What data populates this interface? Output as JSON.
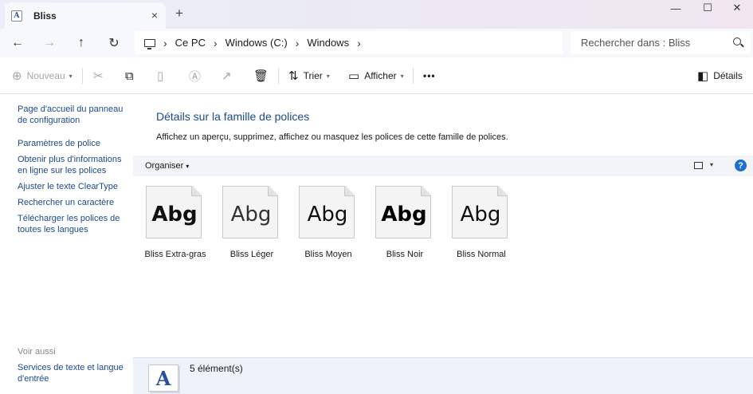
{
  "window": {
    "tab_title": "Bliss",
    "tab_icon_letter": "A",
    "tab_close_icon": "×",
    "new_tab_icon": "+",
    "minimize_icon": "—",
    "maximize_icon": "☐",
    "close_icon": "✕"
  },
  "nav": {
    "back_icon": "←",
    "forward_icon": "→",
    "up_icon": "↑",
    "refresh_icon": "↻",
    "breadcrumb": [
      "Ce PC",
      "Windows (C:)",
      "Windows"
    ],
    "separator": "›",
    "search_placeholder": "Rechercher dans : Bliss"
  },
  "toolbar": {
    "new_label": "Nouveau",
    "sort_label": "Trier",
    "view_label": "Afficher",
    "more_label": "•••",
    "details_label": "Détails"
  },
  "sidebar": {
    "links": [
      "Page d'accueil du panneau de configuration",
      "Paramètres de police",
      "Obtenir plus d'informations en ligne sur les polices",
      "Ajuster le texte ClearType",
      "Rechercher un caractère",
      "Télécharger les polices de toutes les langues"
    ],
    "see_also_label": "Voir aussi",
    "see_also_links": [
      "Services de texte et langue d'entrée"
    ]
  },
  "main": {
    "title": "Détails sur la famille de polices",
    "description": "Affichez un aperçu, supprimez, affichez ou masquez les polices de cette famille de polices.",
    "organize_label": "Organiser",
    "help_label": "?",
    "sample_text": "Abg",
    "fonts": [
      {
        "name": "Bliss Extra-gras",
        "weight": "bold"
      },
      {
        "name": "Bliss Léger",
        "weight": "light"
      },
      {
        "name": "Bliss Moyen",
        "weight": "regular"
      },
      {
        "name": "Bliss Noir",
        "weight": "heavy"
      },
      {
        "name": "Bliss Normal",
        "weight": "regular"
      }
    ]
  },
  "status": {
    "icon_letter": "A",
    "count_text": "5 élément(s)"
  }
}
